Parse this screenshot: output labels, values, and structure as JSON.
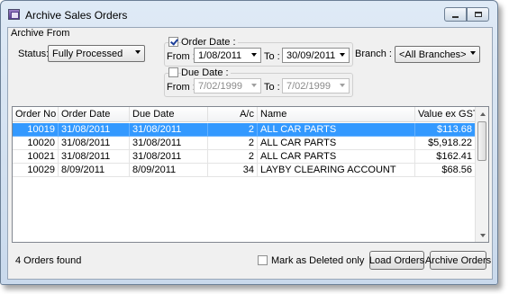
{
  "window": {
    "title": "Archive Sales Orders"
  },
  "archive_from": {
    "label": "Archive From",
    "status_label": "Status:",
    "status_value": "Fully Processed",
    "order_date": {
      "checkbox_label": "Order Date :",
      "checked": true,
      "from_label": "From :",
      "from_value": "1/08/2011",
      "to_label": "To :",
      "to_value": "30/09/2011"
    },
    "branch_label": "Branch :",
    "branch_value": "<All Branches>",
    "due_date": {
      "checkbox_label": "Due Date :",
      "checked": false,
      "from_label": "From :",
      "from_value": "7/02/1999",
      "to_label": "To :",
      "to_value": "7/02/1999"
    }
  },
  "table": {
    "columns": [
      "Order No",
      "Order Date",
      "Due Date",
      "A/c",
      "Name",
      "Value ex GST"
    ],
    "rows": [
      {
        "order_no": "10019",
        "order_date": "31/08/2011",
        "due_date": "31/08/2011",
        "ac": "2",
        "name": "ALL CAR PARTS",
        "value": "$113.68",
        "selected": true
      },
      {
        "order_no": "10020",
        "order_date": "31/08/2011",
        "due_date": "31/08/2011",
        "ac": "2",
        "name": "ALL CAR PARTS",
        "value": "$5,918.22",
        "selected": false
      },
      {
        "order_no": "10021",
        "order_date": "31/08/2011",
        "due_date": "31/08/2011",
        "ac": "2",
        "name": "ALL CAR PARTS",
        "value": "$162.41",
        "selected": false
      },
      {
        "order_no": "10029",
        "order_date": "8/09/2011",
        "due_date": "8/09/2011",
        "ac": "34",
        "name": "LAYBY CLEARING ACCOUNT",
        "value": "$68.56",
        "selected": false
      }
    ]
  },
  "footer": {
    "status_text": "4 Orders found",
    "mark_deleted_label": "Mark as Deleted only",
    "load_button": "Load Orders",
    "archive_button": "Archive Orders"
  }
}
